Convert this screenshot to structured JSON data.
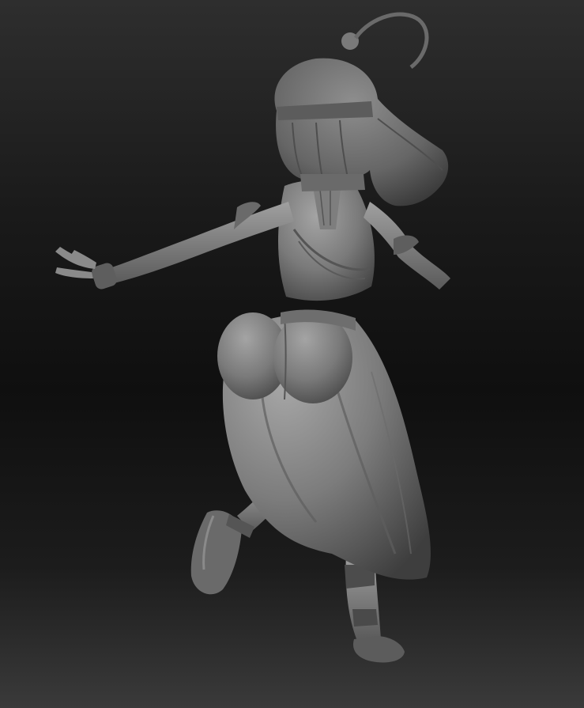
{
  "scene": {
    "subject": "sculpt-render",
    "material": "clay-grey",
    "colors": {
      "background_top": "#2e2e2e",
      "background_mid": "#0f0f0f",
      "background_bottom": "#3a3a3a",
      "clay_light": "#9a9a9a",
      "clay_mid": "#6e6e6e",
      "clay_dark": "#3c3c3c"
    }
  }
}
